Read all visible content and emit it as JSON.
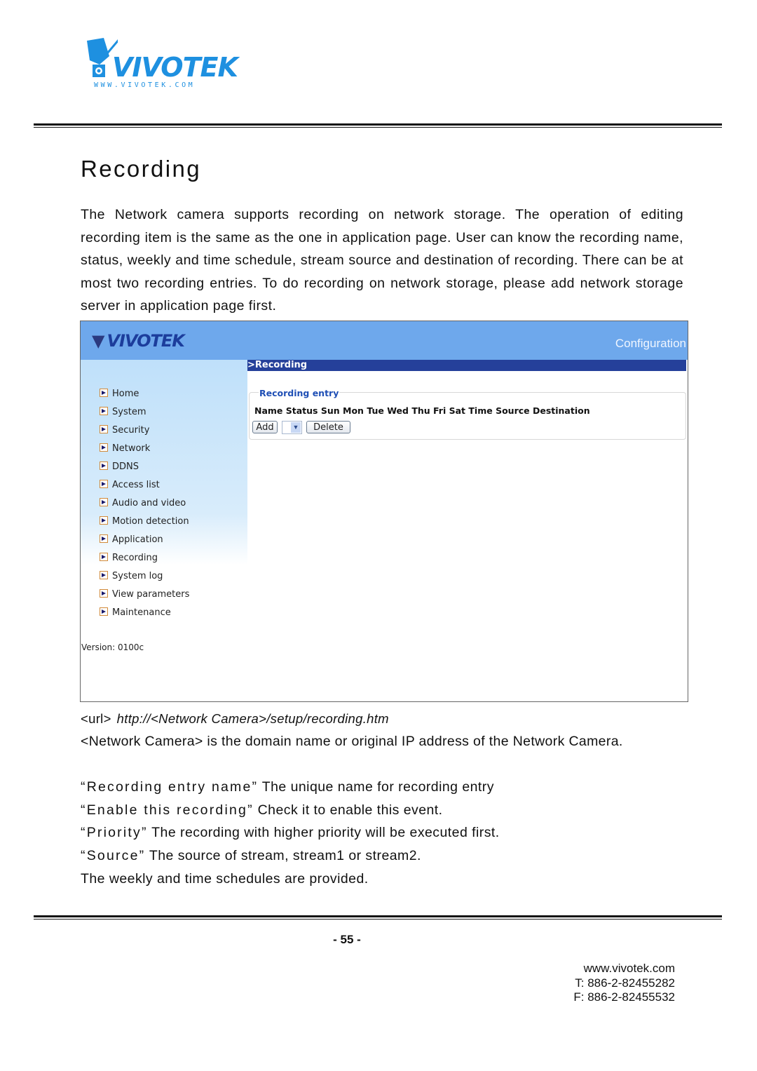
{
  "brand": {
    "logo_text": "VIVOTEK",
    "logo_url": "WWW.VIVOTEK.COM",
    "logo_icon": "camera-icon"
  },
  "page": {
    "title": "Recording",
    "intro": "The Network camera supports recording on network storage. The operation of editing recording item is the same as the one in application page. User can know the recording name, status, weekly and time schedule, stream source and destination of recording. There can be at most two recording entries. To do recording on network storage, please add network storage server in application page first."
  },
  "screenshot": {
    "logo_text": "VIVOTEK",
    "header_label": "Configuration",
    "section_title": ">Recording",
    "sidebar": {
      "items": [
        {
          "label": "Home"
        },
        {
          "label": "System"
        },
        {
          "label": "Security"
        },
        {
          "label": "Network"
        },
        {
          "label": "DDNS"
        },
        {
          "label": "Access list"
        },
        {
          "label": "Audio and video"
        },
        {
          "label": "Motion detection"
        },
        {
          "label": "Application"
        },
        {
          "label": "Recording"
        },
        {
          "label": "System log"
        },
        {
          "label": "View parameters"
        },
        {
          "label": "Maintenance"
        }
      ],
      "version": "Version: 0100c"
    },
    "entry": {
      "legend": "Recording entry",
      "columns": [
        "Name",
        "Status",
        "Sun",
        "Mon",
        "Tue",
        "Wed",
        "Thu",
        "Fri",
        "Sat",
        "Time",
        "Source",
        "Destination"
      ],
      "add_label": "Add",
      "delete_label": "Delete",
      "select_value": ""
    }
  },
  "url": {
    "prefix": "<url>",
    "value": "http://<Network Camera>/setup/recording.htm",
    "description": "<Network Camera> is the domain name or original IP address of the Network Camera."
  },
  "fields": [
    {
      "name": "“Recording entry name”",
      "desc": " The unique name for recording entry"
    },
    {
      "name": "“Enable this recording”",
      "desc": " Check it to enable this event."
    },
    {
      "name": "“Priority”",
      "desc": " The recording with higher priority will be executed first."
    },
    {
      "name": "“Source”",
      "desc": " The source of stream, stream1 or stream2."
    },
    {
      "name": "",
      "desc": "The weekly and time schedules are provided."
    }
  ],
  "footer": {
    "page_number": "- 55 -",
    "website": "www.vivotek.com",
    "phone": "T: 886-2-82455282",
    "fax": "F: 886-2-82455532"
  }
}
